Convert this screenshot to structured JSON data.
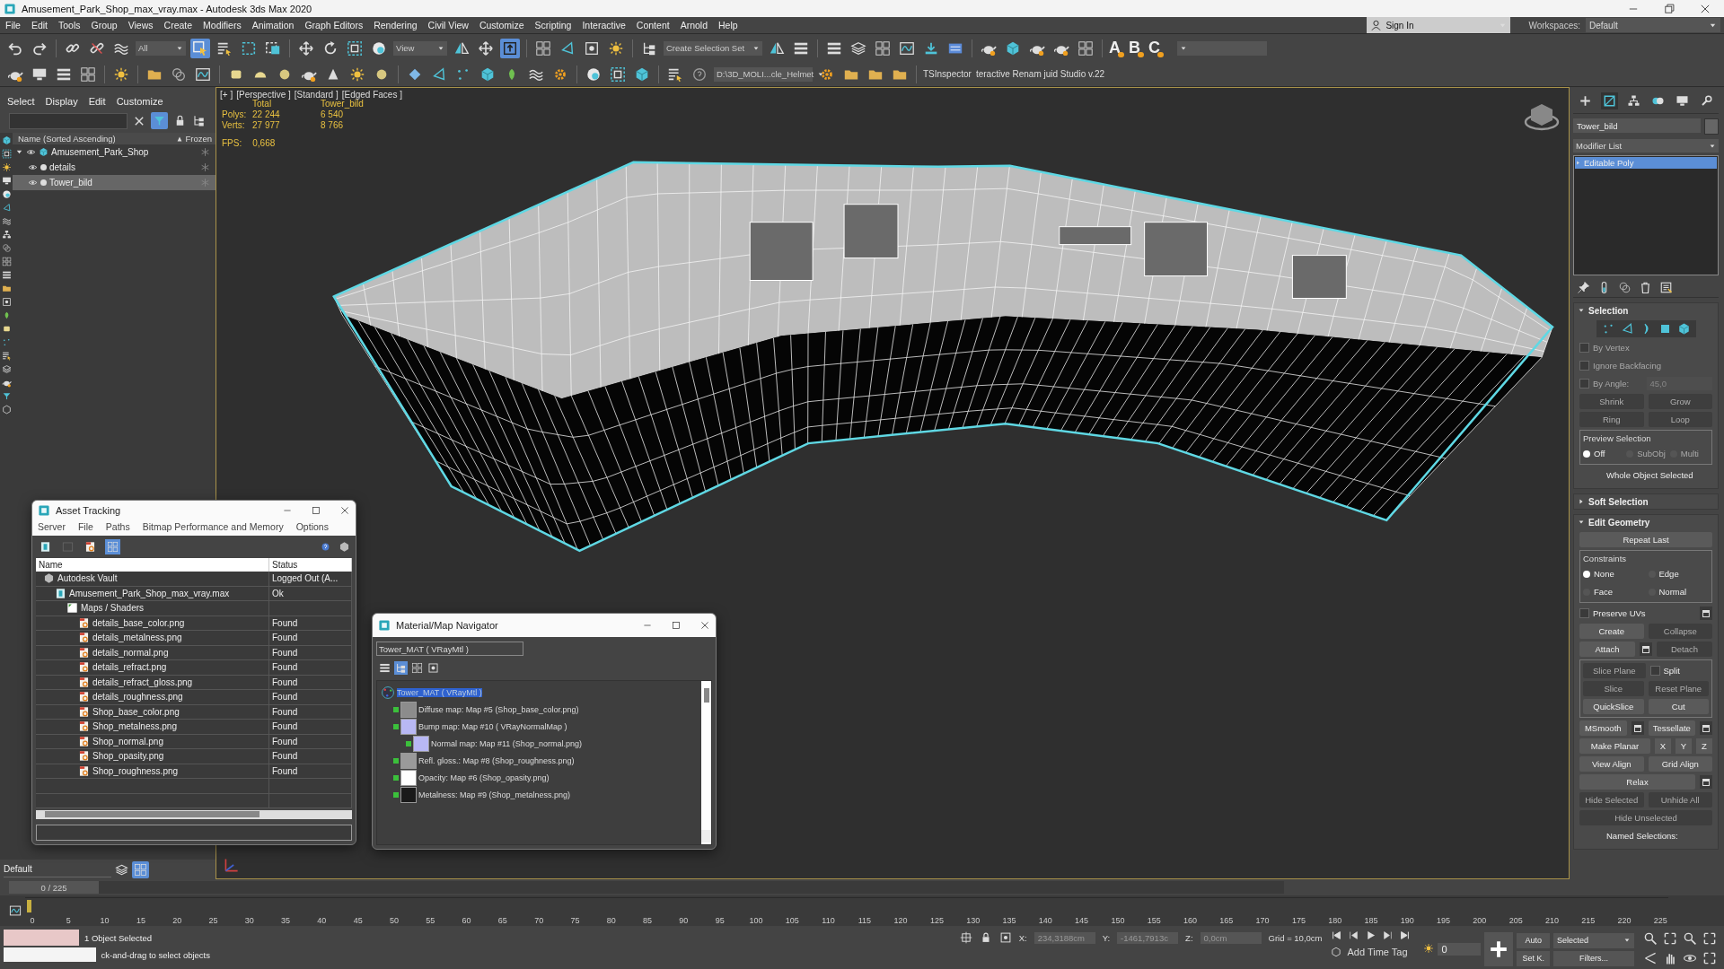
{
  "window": {
    "title": "Amusement_Park_Shop_max_vray.max - Autodesk 3ds Max 2020"
  },
  "menu": [
    "File",
    "Edit",
    "Tools",
    "Group",
    "Views",
    "Create",
    "Modifiers",
    "Animation",
    "Graph Editors",
    "Rendering",
    "Civil View",
    "Customize",
    "Scripting",
    "Interactive",
    "Content",
    "Arnold",
    "Help"
  ],
  "account": {
    "sign_in": "Sign In",
    "workspaces_label": "Workspaces:",
    "workspace": "Default"
  },
  "main_toolbar": {
    "selection_filter": "All",
    "select_tool_on": true,
    "reference_coord": "View",
    "pivot_tool_on": true,
    "selection_set": "Create Selection Set",
    "letter_buttons": [
      "A",
      "B",
      "C"
    ]
  },
  "secondary_toolbar": {
    "project_path": "D:\\3D_MOLI...cle_Helmet",
    "scripts": [
      "TSInspector",
      "teractive Renam juid Studio v.22"
    ]
  },
  "scene_explorer": {
    "tabs": [
      "Select",
      "Display",
      "Edit",
      "Customize"
    ],
    "columns": [
      "Name (Sorted Ascending)",
      "Frozen"
    ],
    "tree": [
      {
        "name": "Amusement_Park_Shop",
        "selected": false,
        "expanded": true,
        "children": [
          {
            "name": "details",
            "selected": false
          },
          {
            "name": "Tower_bild",
            "selected": true
          }
        ]
      }
    ]
  },
  "layer": {
    "name": "Default"
  },
  "viewport": {
    "labels": [
      "[+ ]",
      "[Perspective ]",
      "[Standard ]",
      "[Edged Faces ]"
    ],
    "stats": {
      "columns": [
        "Total",
        "Tower_bild"
      ],
      "rows": [
        {
          "label": "Polys:",
          "values": [
            "22 244",
            "6 540"
          ]
        },
        {
          "label": "Verts:",
          "values": [
            "27 977",
            "8 766"
          ]
        }
      ],
      "fps_label": "FPS:",
      "fps": "0,668"
    }
  },
  "asset_tracking": {
    "title": "Asset Tracking",
    "menu": [
      "Server",
      "File",
      "Paths",
      "Bitmap Performance and Memory",
      "Options"
    ],
    "columns": [
      "Name",
      "Status"
    ],
    "tree": [
      {
        "name": "Autodesk Vault",
        "kind": "vault",
        "status": "Logged Out (A...",
        "children": [
          {
            "name": "Amusement_Park_Shop_max_vray.max",
            "kind": "scene",
            "status": "Ok",
            "children": [
              {
                "name": "Maps / Shaders",
                "kind": "folder",
                "children": [
                  {
                    "name": "details_base_color.png",
                    "kind": "image",
                    "status": "Found"
                  },
                  {
                    "name": "details_metalness.png",
                    "kind": "image",
                    "status": "Found"
                  },
                  {
                    "name": "details_normal.png",
                    "kind": "image",
                    "status": "Found"
                  },
                  {
                    "name": "details_refract.png",
                    "kind": "image",
                    "status": "Found"
                  },
                  {
                    "name": "details_refract_gloss.png",
                    "kind": "image",
                    "status": "Found"
                  },
                  {
                    "name": "details_roughness.png",
                    "kind": "image",
                    "status": "Found"
                  },
                  {
                    "name": "Shop_base_color.png",
                    "kind": "image",
                    "status": "Found"
                  },
                  {
                    "name": "Shop_metalness.png",
                    "kind": "image",
                    "status": "Found"
                  },
                  {
                    "name": "Shop_normal.png",
                    "kind": "image",
                    "status": "Found"
                  },
                  {
                    "name": "Shop_opasity.png",
                    "kind": "image",
                    "status": "Found"
                  },
                  {
                    "name": "Shop_roughness.png",
                    "kind": "image",
                    "status": "Found"
                  }
                ]
              }
            ]
          }
        ]
      }
    ]
  },
  "material_navigator": {
    "title": "Material/Map Navigator",
    "current": "Tower_MAT  ( VRayMtl )",
    "tree": [
      {
        "name": "Tower_MAT  ( VRayMtl )",
        "selected": true,
        "kind": "material",
        "children": [
          {
            "name": "Diffuse map: Map #5 (Shop_base_color.png)",
            "selected": false,
            "kind": "map",
            "color": "#8c8c8c"
          },
          {
            "name": "Bump map: Map #10  ( VRayNormalMap )",
            "selected": false,
            "kind": "map",
            "color": "#b8b8f4",
            "children": [
              {
                "name": "Normal map: Map #11 (Shop_normal.png)",
                "selected": false,
                "kind": "map",
                "color": "#b8b8f4"
              }
            ]
          },
          {
            "name": "Refl. gloss.: Map #8 (Shop_roughness.png)",
            "selected": false,
            "kind": "map",
            "color": "#9a9a9a"
          },
          {
            "name": "Opacity: Map #6 (Shop_opasity.png)",
            "selected": false,
            "kind": "map",
            "color": "#ffffff"
          },
          {
            "name": "Metalness: Map #9 (Shop_metalness.png)",
            "selected": false,
            "kind": "map",
            "color": "#1a1a1a"
          }
        ]
      }
    ]
  },
  "command_panel": {
    "object_name": "Tower_bild",
    "modifier_list": "Modifier List",
    "modifiers": [
      {
        "label": "Editable Poly",
        "selected": true
      }
    ],
    "rollouts": [
      {
        "title": "Selection",
        "expanded": true,
        "rows": [
          {
            "items": [
              {
                "kind": "subobject_icons"
              }
            ]
          },
          {
            "items": [
              {
                "kind": "check",
                "label": "By Vertex",
                "checked": false,
                "disabled": true
              }
            ]
          },
          {
            "items": [
              {
                "kind": "check",
                "label": "Ignore Backfacing",
                "checked": false,
                "disabled": true
              }
            ]
          },
          {
            "items": [
              {
                "kind": "check",
                "label": "By Angle:",
                "checked": false,
                "disabled": true
              },
              {
                "kind": "spinner",
                "value": "45,0",
                "disabled": true
              }
            ]
          },
          {
            "items": [
              {
                "kind": "button",
                "label": "Shrink",
                "disabled": true
              },
              {
                "kind": "button",
                "label": "Grow",
                "disabled": true
              }
            ]
          },
          {
            "items": [
              {
                "kind": "button",
                "label": "Ring",
                "disabled": true
              },
              {
                "kind": "button",
                "label": "Loop",
                "disabled": true
              }
            ]
          },
          {
            "title": "Preview Selection",
            "rows": [
              {
                "items": [
                  {
                    "kind": "radio",
                    "label": "Off",
                    "selected": true,
                    "disabled": false
                  },
                  {
                    "kind": "radio",
                    "label": "SubObj",
                    "selected": false,
                    "disabled": true
                  },
                  {
                    "kind": "radio",
                    "label": "Multi",
                    "selected": false,
                    "disabled": true
                  }
                ]
              }
            ]
          },
          {
            "items": [
              {
                "kind": "note",
                "label": "Whole Object Selected"
              }
            ]
          }
        ]
      },
      {
        "title": "Soft Selection",
        "expanded": false
      },
      {
        "title": "Edit Geometry",
        "expanded": true,
        "rows": [
          {
            "items": [
              {
                "kind": "button",
                "label": "Repeat Last",
                "disabled": false
              }
            ]
          },
          {
            "title": "Constraints",
            "rows": [
              {
                "items": [
                  {
                    "kind": "radio",
                    "label": "None",
                    "selected": true,
                    "disabled": false
                  },
                  {
                    "kind": "radio",
                    "label": "Edge",
                    "selected": false,
                    "disabled": false
                  }
                ]
              },
              {
                "items": [
                  {
                    "kind": "radio",
                    "label": "Face",
                    "selected": false,
                    "disabled": false
                  },
                  {
                    "kind": "radio",
                    "label": "Normal",
                    "selected": false,
                    "disabled": false
                  }
                ]
              }
            ]
          },
          {
            "items": [
              {
                "kind": "check",
                "label": "Preserve UVs",
                "checked": false,
                "disabled": false
              },
              {
                "kind": "settings"
              }
            ]
          },
          {
            "items": [
              {
                "kind": "button",
                "label": "Create",
                "disabled": false
              },
              {
                "kind": "button",
                "label": "Collapse",
                "disabled": true
              }
            ]
          },
          {
            "items": [
              {
                "kind": "button",
                "label": "Attach",
                "disabled": false
              },
              {
                "kind": "settings"
              },
              {
                "kind": "button",
                "label": "Detach",
                "disabled": true
              }
            ]
          },
          {
            "title": "",
            "rows": [
              {
                "items": [
                  {
                    "kind": "button",
                    "label": "Slice Plane",
                    "disabled": true
                  },
                  {
                    "kind": "check",
                    "label": "Split",
                    "checked": false,
                    "disabled": false
                  }
                ]
              },
              {
                "items": [
                  {
                    "kind": "button",
                    "label": "Slice",
                    "disabled": true
                  },
                  {
                    "kind": "button",
                    "label": "Reset Plane",
                    "disabled": true
                  }
                ]
              },
              {
                "items": [
                  {
                    "kind": "button",
                    "label": "QuickSlice",
                    "disabled": false
                  },
                  {
                    "kind": "button",
                    "label": "Cut",
                    "disabled": false
                  }
                ]
              }
            ]
          },
          {
            "items": [
              {
                "kind": "button",
                "label": "MSmooth",
                "disabled": false
              },
              {
                "kind": "settings"
              },
              {
                "kind": "button",
                "label": "Tessellate",
                "disabled": false
              },
              {
                "kind": "settings"
              }
            ]
          },
          {
            "items": [
              {
                "kind": "button",
                "label": "Make Planar",
                "disabled": false
              },
              {
                "kind": "small_button",
                "label": "X",
                "disabled": false
              },
              {
                "kind": "small_button",
                "label": "Y",
                "disabled": false
              },
              {
                "kind": "small_button",
                "label": "Z",
                "disabled": false
              }
            ]
          },
          {
            "items": [
              {
                "kind": "button",
                "label": "View Align",
                "disabled": false
              },
              {
                "kind": "button",
                "label": "Grid Align",
                "disabled": false
              }
            ]
          },
          {
            "items": [
              {
                "kind": "button",
                "label": "Relax",
                "disabled": false
              },
              {
                "kind": "settings"
              }
            ]
          },
          {
            "items": [
              {
                "kind": "button",
                "label": "Hide Selected",
                "disabled": true
              },
              {
                "kind": "button",
                "label": "Unhide All",
                "disabled": true
              }
            ]
          },
          {
            "items": [
              {
                "kind": "button",
                "label": "Hide Unselected",
                "disabled": true
              }
            ]
          },
          {
            "items": [
              {
                "kind": "note",
                "label": "Named Selections:"
              }
            ]
          }
        ]
      }
    ]
  },
  "time_slider": {
    "label": "0 / 225",
    "level": 0
  },
  "timeline": {
    "ticks": [
      "0",
      "5",
      "10",
      "15",
      "20",
      "25",
      "30",
      "35",
      "40",
      "45",
      "50",
      "55",
      "60",
      "65",
      "70",
      "75",
      "80",
      "85",
      "90",
      "95",
      "100",
      "105",
      "110",
      "115",
      "120",
      "125",
      "130",
      "135",
      "140",
      "145",
      "150",
      "155",
      "160",
      "165",
      "170",
      "175",
      "180",
      "185",
      "190",
      "195",
      "200",
      "205",
      "210",
      "215",
      "220",
      "225"
    ]
  },
  "status_bar": {
    "selection": "1 Object Selected",
    "prompt": "ck-and-drag to select objects",
    "coords": [
      {
        "label": "X:",
        "value": "234,3188cm"
      },
      {
        "label": "Y:",
        "value": "-1461,7913c"
      },
      {
        "label": "Z:",
        "value": "0,0cm"
      }
    ],
    "grid": "Grid = 10,0cm",
    "time_tag": "Add Time Tag",
    "key_mode": "Auto",
    "key_filter": "Selected",
    "set_key": "Set K.",
    "filters": "Filters...",
    "frame": "0"
  }
}
